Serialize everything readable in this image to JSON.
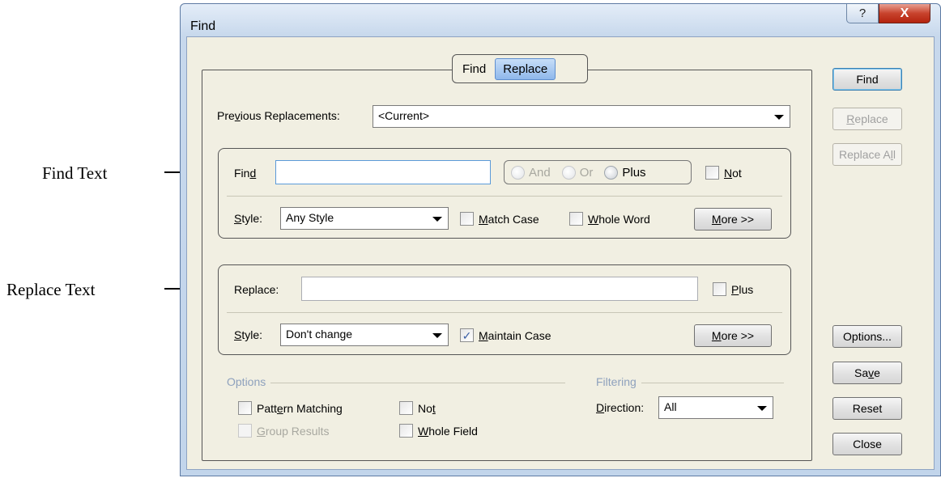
{
  "annotations": {
    "find_text": "Find Text",
    "replace_text": "Replace Text"
  },
  "window": {
    "title": "Find",
    "help_label": "?",
    "close_label": "X"
  },
  "tabs": [
    {
      "label": "Find",
      "active": false
    },
    {
      "label": "Replace",
      "active": true
    }
  ],
  "previous_replacements": {
    "label_pre": "Pre",
    "label_u": "v",
    "label_post": "ious Replacements:",
    "value": "<Current>"
  },
  "find_group": {
    "find_label_pre": "Fin",
    "find_label_u": "d",
    "find_value": "",
    "radios": [
      {
        "label": "And",
        "disabled": true
      },
      {
        "label": "Or",
        "disabled": true
      },
      {
        "label": "Plus",
        "disabled": false
      }
    ],
    "not_u": "N",
    "not_rest": "ot",
    "style_u": "S",
    "style_rest": "tyle:",
    "style_value": "Any Style",
    "match_case_u": "M",
    "match_case_rest": "atch Case",
    "whole_word_u": "W",
    "whole_word_rest": "hole Word",
    "more_u": "M",
    "more_rest": "ore >>"
  },
  "replace_group": {
    "replace_label": "Replace:",
    "replace_value": "",
    "plus_u": "P",
    "plus_rest": "lus",
    "style_u": "S",
    "style_rest": "tyle:",
    "style_value": "Don't change",
    "maintain_u": "M",
    "maintain_rest": "aintain Case",
    "maintain_checked": "✓",
    "more_u": "M",
    "more_rest": "ore >>"
  },
  "options": {
    "title": "Options",
    "pattern_pre": "Patt",
    "pattern_u": "e",
    "pattern_post": "rn Matching",
    "not_pre": "No",
    "not_u": "t",
    "group_u": "G",
    "group_rest": "roup Results",
    "whole_field_u": "W",
    "whole_field_rest": "hole Field"
  },
  "filtering": {
    "title": "Filtering",
    "direction_u": "D",
    "direction_rest": "irection:",
    "direction_value": "All"
  },
  "buttons": {
    "find": "Find",
    "replace_u": "R",
    "replace_rest": "eplace",
    "replace_all_pre": "Replace A",
    "replace_all_u": "l",
    "replace_all_post": "l",
    "options": "Options...",
    "save_pre": "Sa",
    "save_u": "v",
    "save_post": "e",
    "reset": "Reset",
    "close": "Close"
  }
}
